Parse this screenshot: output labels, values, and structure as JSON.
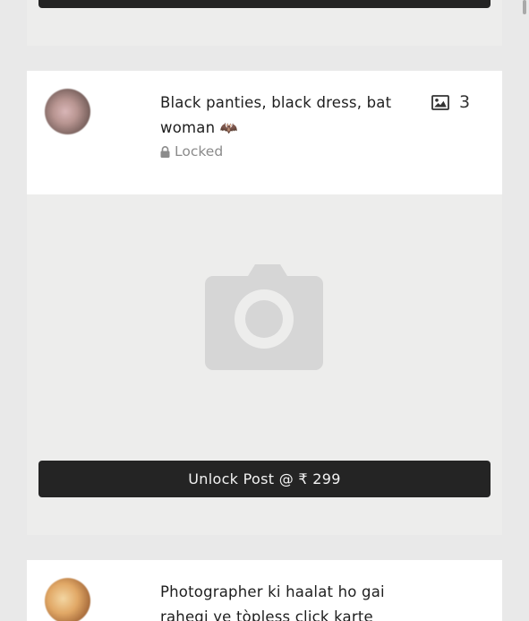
{
  "previous_post": {},
  "post": {
    "title": "Black panties, black dress, bat woman",
    "title_emoji": "🦇",
    "status": "Locked",
    "media_count": "3",
    "unlock_button": "Unlock Post @ ₹ 299",
    "icons": {
      "avatar": "avatar",
      "lock": "lock-icon",
      "media": "image-icon",
      "placeholder": "camera-icon"
    }
  },
  "next_post": {
    "title": "Photographer ki haalat ho gai rahegi ye tòpless click karte"
  },
  "colors": {
    "page_bg": "#e9e9e9",
    "card_bg": "#ffffff",
    "preview_bg": "#ededec",
    "button_bg": "#242424",
    "button_text": "#f2f2f2",
    "muted_text": "#8b8b8b",
    "placeholder_icon": "#d6d6d6"
  }
}
